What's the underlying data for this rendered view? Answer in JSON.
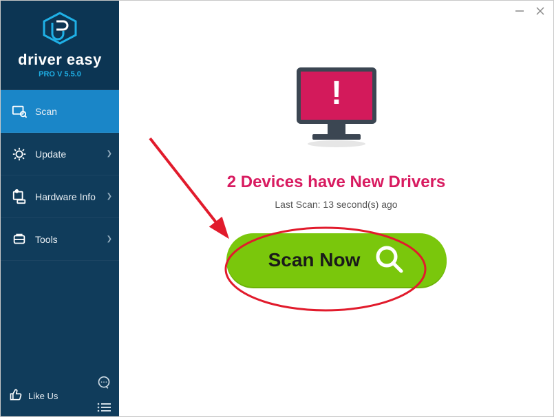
{
  "app": {
    "name": "driver easy",
    "version": "PRO V 5.5.0"
  },
  "sidebar": {
    "items": [
      {
        "label": "Scan"
      },
      {
        "label": "Update"
      },
      {
        "label": "Hardware Info"
      },
      {
        "label": "Tools"
      }
    ],
    "like_label": "Like Us"
  },
  "main": {
    "status_heading": "2 Devices have New Drivers",
    "last_scan_text": "Last Scan: 13 second(s) ago",
    "scan_button_label": "Scan Now"
  },
  "colors": {
    "sidebar_bg": "#103c5b",
    "sidebar_header_bg": "#0c3553",
    "sidebar_active": "#1a86c8",
    "brand_link": "#1fb0e6",
    "alert_pink": "#d81b60",
    "scan_green": "#7ac70c"
  }
}
